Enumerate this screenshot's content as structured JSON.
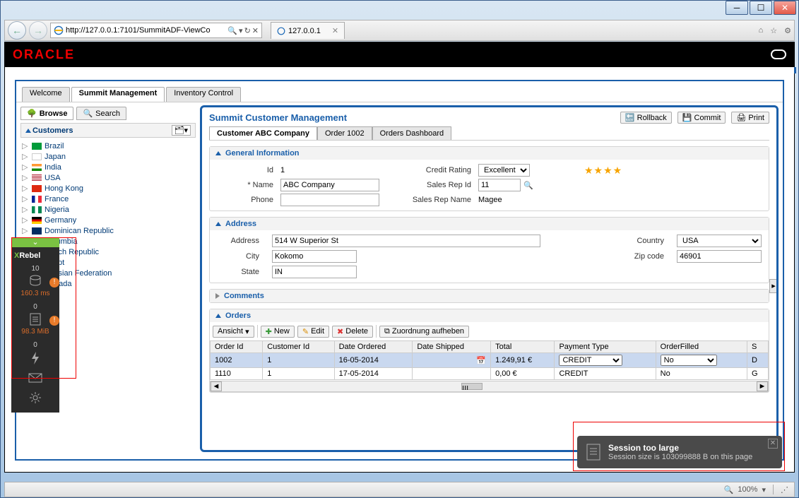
{
  "browser": {
    "url": "http://127.0.0.1:7101/SummitADF-ViewCo",
    "tab_title": "127.0.0.1",
    "zoom": "100%"
  },
  "oracle_logo": "ORACLE",
  "main_tabs": [
    "Welcome",
    "Summit Management",
    "Inventory Control"
  ],
  "main_tab_active": 1,
  "left": {
    "browse": "Browse",
    "search": "Search",
    "customers_hdr": "Customers",
    "items": [
      {
        "flag": "br",
        "label": "Brazil"
      },
      {
        "flag": "jp",
        "label": "Japan"
      },
      {
        "flag": "in",
        "label": "India"
      },
      {
        "flag": "us",
        "label": "USA"
      },
      {
        "flag": "hk",
        "label": "Hong Kong"
      },
      {
        "flag": "fr",
        "label": "France"
      },
      {
        "flag": "ng",
        "label": "Nigeria"
      },
      {
        "flag": "de",
        "label": "Germany"
      },
      {
        "flag": "do",
        "label": "Dominican Republic"
      },
      {
        "flag": "co",
        "label": "Columbia"
      },
      {
        "flag": "cz",
        "label": "Czech Republic"
      },
      {
        "flag": "eg",
        "label": "Egypt"
      },
      {
        "flag": "ru",
        "label": "Russian Federation"
      },
      {
        "flag": "ca",
        "label": "Canada"
      }
    ]
  },
  "panel": {
    "title": "Summit Customer Management",
    "rollback": "Rollback",
    "commit": "Commit",
    "print": "Print",
    "sub_tabs": [
      "Customer ABC Company",
      "Order 1002",
      "Orders Dashboard"
    ],
    "sub_tab_active": 0,
    "general": {
      "hdr": "General Information",
      "id_lbl": "Id",
      "id": "1",
      "name_lbl": "Name",
      "name": "ABC Company",
      "name_req": "*",
      "phone_lbl": "Phone",
      "phone": "",
      "credit_lbl": "Credit Rating",
      "credit": "Excellent",
      "rep_id_lbl": "Sales Rep Id",
      "rep_id": "11",
      "rep_name_lbl": "Sales Rep Name",
      "rep_name": "Magee"
    },
    "address": {
      "hdr": "Address",
      "addr_lbl": "Address",
      "addr": "514 W Superior St",
      "city_lbl": "City",
      "city": "Kokomo",
      "state_lbl": "State",
      "state": "IN",
      "country_lbl": "Country",
      "country": "USA",
      "zip_lbl": "Zip code",
      "zip": "46901"
    },
    "comments_hdr": "Comments",
    "orders": {
      "hdr": "Orders",
      "view": "Ansicht",
      "new": "New",
      "edit": "Edit",
      "delete": "Delete",
      "detach": "Zuordnung aufheben",
      "cols": [
        "Order Id",
        "Customer Id",
        "Date Ordered",
        "Date Shipped",
        "Total",
        "Payment Type",
        "OrderFilled",
        "S"
      ],
      "rows": [
        {
          "order_id": "1002",
          "customer_id": "1",
          "date_ordered": "16-05-2014",
          "date_shipped": "",
          "total": "1.249,91 €",
          "payment": "CREDIT",
          "filled": "No",
          "s": "D"
        },
        {
          "order_id": "1110",
          "customer_id": "1",
          "date_ordered": "17-05-2014",
          "date_shipped": "",
          "total": "0,00 €",
          "payment": "CREDIT",
          "filled": "No",
          "s": "G"
        }
      ]
    }
  },
  "xrebel": {
    "logo": "Rebel",
    "db_count": "10",
    "db_time": "160.3 ms",
    "app_count": "0",
    "app_size": "98.3 MiB",
    "bolt": "0"
  },
  "toast": {
    "title": "Session too large",
    "msg": "Session size is 103099888 B on this page"
  }
}
